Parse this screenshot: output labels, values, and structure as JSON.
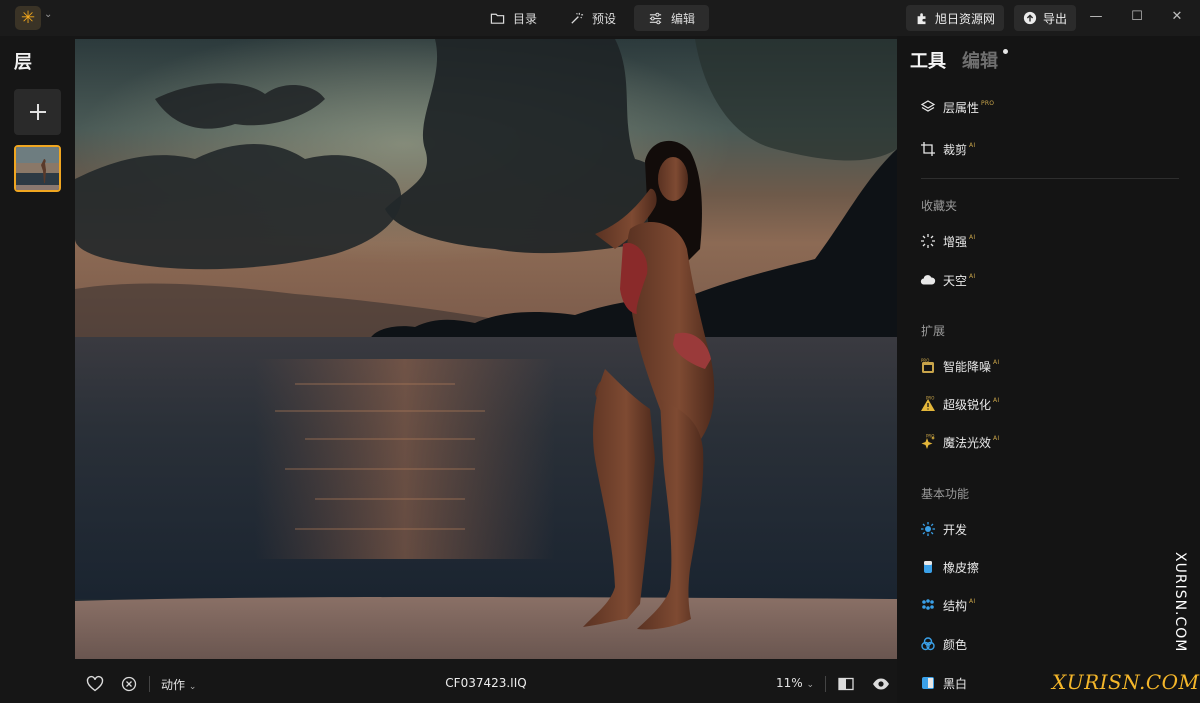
{
  "titlebar": {
    "app_icon": "sun-sparkle-icon",
    "nav_tabs": [
      {
        "label": "目录",
        "icon": "folder-icon"
      },
      {
        "label": "预设",
        "icon": "magic-wand-icon"
      },
      {
        "label": "编辑",
        "icon": "sliders-icon",
        "active": true
      }
    ],
    "brand_button": "旭日资源网",
    "export_button": "导出",
    "window_controls": [
      "minimize",
      "maximize",
      "close"
    ]
  },
  "layers": {
    "title": "层",
    "add_icon": "plus-icon"
  },
  "bottom_bar": {
    "actions_label": "动作",
    "filename": "CF037423.IIQ",
    "zoom": "11%"
  },
  "right_panel": {
    "tabs": {
      "tools": "工具",
      "edits": "编辑"
    },
    "top_tools": [
      {
        "label": "层属性",
        "badge": "PRO",
        "icon": "layers-icon"
      },
      {
        "label": "裁剪",
        "badge": "AI",
        "icon": "crop-icon"
      }
    ],
    "favorites_title": "收藏夹",
    "favorites": [
      {
        "label": "增强",
        "badge": "AI",
        "icon": "sparkle-burst-icon"
      },
      {
        "label": "天空",
        "badge": "AI",
        "icon": "cloud-icon"
      }
    ],
    "extensions_title": "扩展",
    "extensions": [
      {
        "label": "智能降噪",
        "badge": "AI",
        "icon": "denoise-pro-icon"
      },
      {
        "label": "超级锐化",
        "badge": "AI",
        "icon": "sharpen-pro-icon"
      },
      {
        "label": "魔法光效",
        "badge": "AI",
        "icon": "magic-light-pro-icon"
      }
    ],
    "basics_title": "基本功能",
    "basics": [
      {
        "label": "开发",
        "icon": "develop-sun-icon"
      },
      {
        "label": "橡皮擦",
        "icon": "eraser-icon"
      },
      {
        "label": "结构",
        "badge": "AI",
        "icon": "structure-dots-icon"
      },
      {
        "label": "颜色",
        "icon": "color-circles-icon"
      },
      {
        "label": "黑白",
        "icon": "black-white-icon"
      }
    ]
  },
  "watermarks": {
    "vertical": "XURISN.COM",
    "logo": "XURISN.COM"
  },
  "colors": {
    "accent_orange": "#f0a620",
    "pro_gold": "#c8a44a",
    "tool_blue": "#3aa0e8"
  }
}
